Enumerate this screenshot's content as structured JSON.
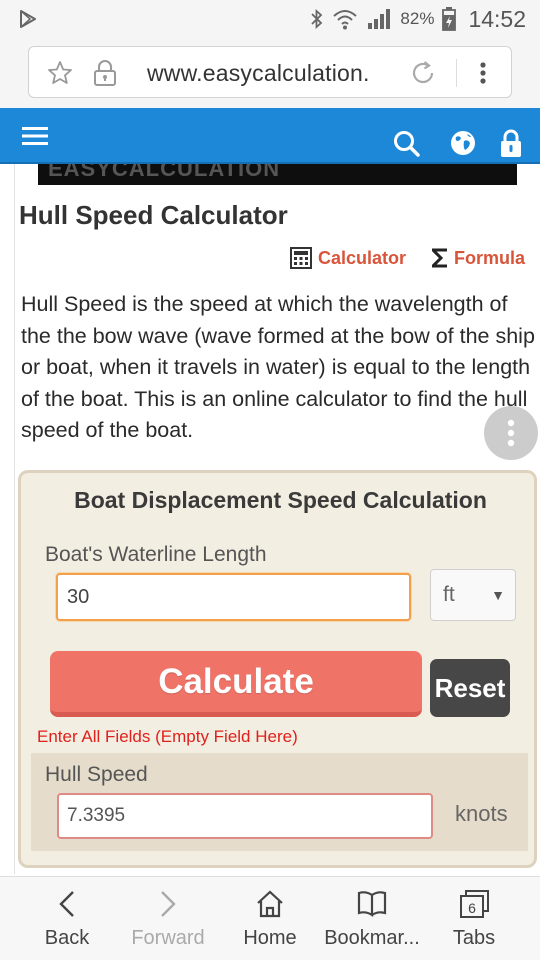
{
  "status_bar": {
    "battery_pct": "82%",
    "time": "14:52"
  },
  "browser": {
    "url": "www.easycalculation.",
    "bottom_nav": [
      {
        "label": "Back"
      },
      {
        "label": "Forward"
      },
      {
        "label": "Home"
      },
      {
        "label": "Bookmar..."
      },
      {
        "label": "Tabs",
        "count": "6"
      }
    ]
  },
  "site": {
    "header_color": "#1e88d8",
    "banner_text": "EASYCALCULATION",
    "page_title": "Hull Speed Calculator",
    "tabs": [
      {
        "label": "Calculator"
      },
      {
        "label": "Formula"
      }
    ],
    "description": "Hull Speed is the speed at which the wavelength of the the bow wave (wave formed at the bow of the ship or boat, when it travels in water) is equal to the length of the boat. This is an online calculator to find the hull speed of the boat."
  },
  "calculator": {
    "heading": "Boat Displacement Speed Calculation",
    "waterline_label": "Boat's Waterline Length",
    "waterline_value": "30",
    "unit_selected": "ft",
    "calculate_label": "Calculate",
    "reset_label": "Reset",
    "error_message": "Enter All Fields (Empty Field Here)",
    "result_label": "Hull Speed",
    "result_value": "7.3395",
    "result_unit": "knots",
    "accent_color": "#f07368"
  }
}
